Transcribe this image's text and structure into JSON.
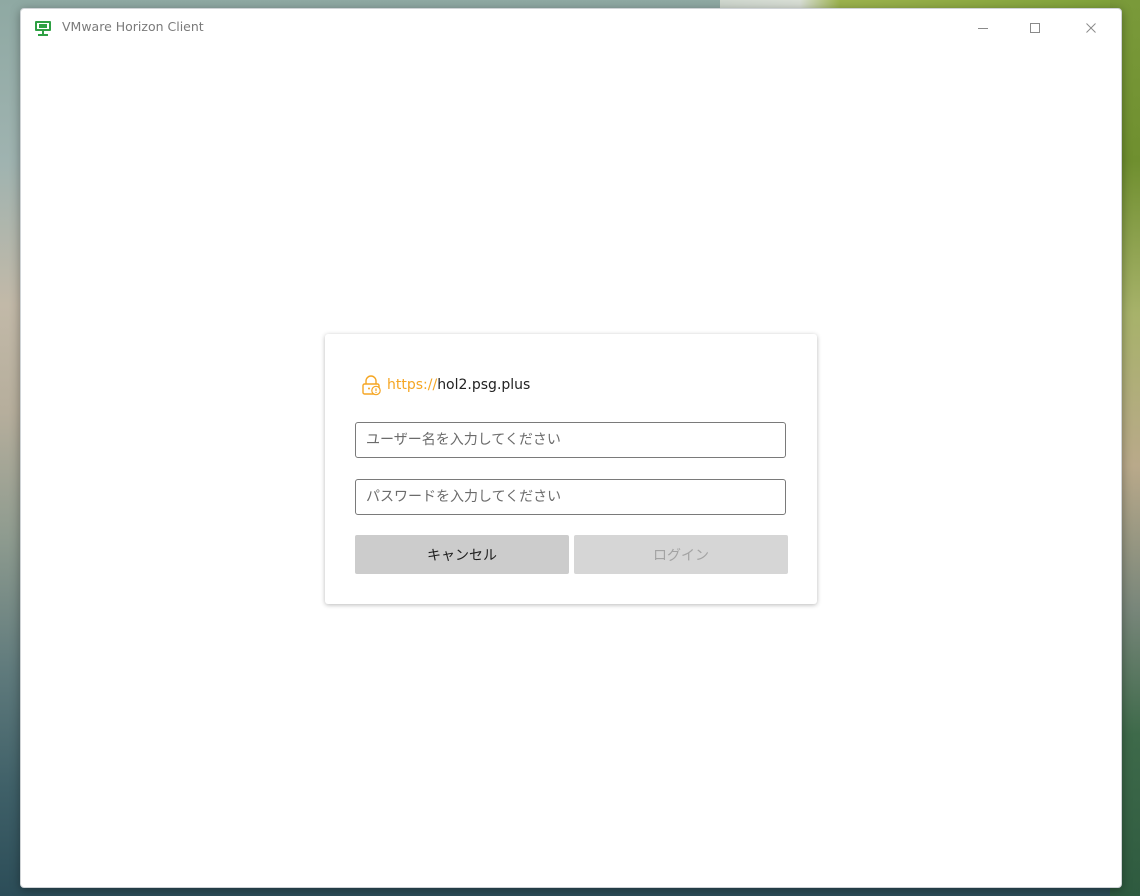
{
  "window": {
    "title": "VMware Horizon Client",
    "controls": {
      "minimize": "—",
      "maximize": "☐",
      "close": "✕"
    }
  },
  "login": {
    "server_scheme": "https://",
    "server_host": "hol2.psg.plus",
    "username_placeholder": "ユーザー名を入力してください",
    "password_placeholder": "パスワードを入力してください",
    "cancel_label": "キャンセル",
    "login_label": "ログイン",
    "login_enabled": false
  },
  "icons": {
    "app": "vmware-horizon-icon",
    "server_lock": "lock-warning-icon"
  },
  "colors": {
    "scheme_accent": "#f5a623",
    "app_icon_green": "#2ea043",
    "cancel_button_bg": "#cccccc",
    "login_button_bg_disabled": "#d6d6d6"
  }
}
